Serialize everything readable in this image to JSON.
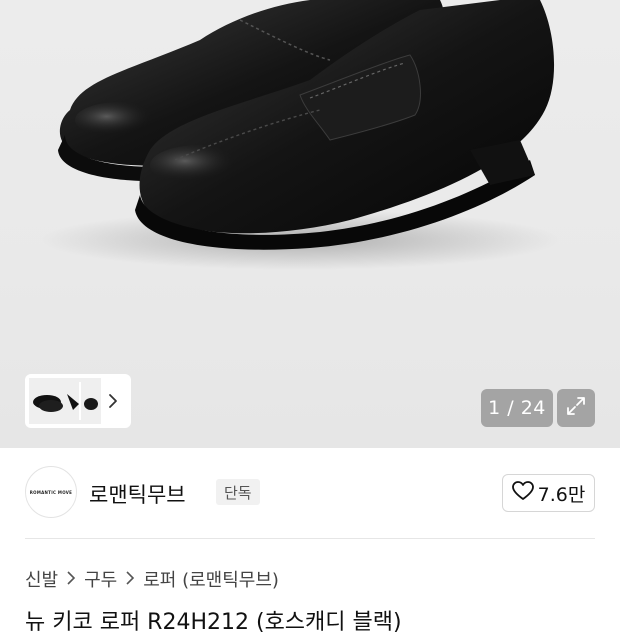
{
  "gallery": {
    "counter": "1 / 24",
    "expand_icon": "expand-icon",
    "thumbnail_next_icon": "chevron-right-icon"
  },
  "brand": {
    "logo_text": "ROMANTIC MOVE",
    "name": "로맨틱무브",
    "badge": "단독"
  },
  "like": {
    "icon": "heart-icon",
    "count": "7.6만"
  },
  "breadcrumb": {
    "items": [
      "신발",
      "구두",
      "로퍼 (로맨틱무브)"
    ],
    "separator_icon": "chevron-right-icon"
  },
  "product": {
    "title": "뉴 키코 로퍼 R24H212 (호스캐디 블랙)"
  }
}
